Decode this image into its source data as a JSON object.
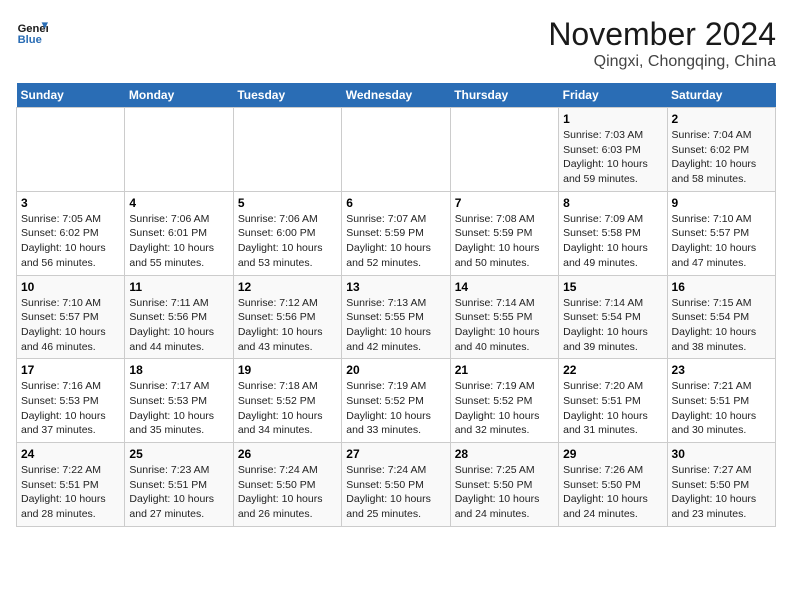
{
  "header": {
    "logo_line1": "General",
    "logo_line2": "Blue",
    "month": "November 2024",
    "location": "Qingxi, Chongqing, China"
  },
  "weekdays": [
    "Sunday",
    "Monday",
    "Tuesday",
    "Wednesday",
    "Thursday",
    "Friday",
    "Saturday"
  ],
  "weeks": [
    [
      {
        "day": "",
        "info": ""
      },
      {
        "day": "",
        "info": ""
      },
      {
        "day": "",
        "info": ""
      },
      {
        "day": "",
        "info": ""
      },
      {
        "day": "",
        "info": ""
      },
      {
        "day": "1",
        "info": "Sunrise: 7:03 AM\nSunset: 6:03 PM\nDaylight: 10 hours and 59 minutes."
      },
      {
        "day": "2",
        "info": "Sunrise: 7:04 AM\nSunset: 6:02 PM\nDaylight: 10 hours and 58 minutes."
      }
    ],
    [
      {
        "day": "3",
        "info": "Sunrise: 7:05 AM\nSunset: 6:02 PM\nDaylight: 10 hours and 56 minutes."
      },
      {
        "day": "4",
        "info": "Sunrise: 7:06 AM\nSunset: 6:01 PM\nDaylight: 10 hours and 55 minutes."
      },
      {
        "day": "5",
        "info": "Sunrise: 7:06 AM\nSunset: 6:00 PM\nDaylight: 10 hours and 53 minutes."
      },
      {
        "day": "6",
        "info": "Sunrise: 7:07 AM\nSunset: 5:59 PM\nDaylight: 10 hours and 52 minutes."
      },
      {
        "day": "7",
        "info": "Sunrise: 7:08 AM\nSunset: 5:59 PM\nDaylight: 10 hours and 50 minutes."
      },
      {
        "day": "8",
        "info": "Sunrise: 7:09 AM\nSunset: 5:58 PM\nDaylight: 10 hours and 49 minutes."
      },
      {
        "day": "9",
        "info": "Sunrise: 7:10 AM\nSunset: 5:57 PM\nDaylight: 10 hours and 47 minutes."
      }
    ],
    [
      {
        "day": "10",
        "info": "Sunrise: 7:10 AM\nSunset: 5:57 PM\nDaylight: 10 hours and 46 minutes."
      },
      {
        "day": "11",
        "info": "Sunrise: 7:11 AM\nSunset: 5:56 PM\nDaylight: 10 hours and 44 minutes."
      },
      {
        "day": "12",
        "info": "Sunrise: 7:12 AM\nSunset: 5:56 PM\nDaylight: 10 hours and 43 minutes."
      },
      {
        "day": "13",
        "info": "Sunrise: 7:13 AM\nSunset: 5:55 PM\nDaylight: 10 hours and 42 minutes."
      },
      {
        "day": "14",
        "info": "Sunrise: 7:14 AM\nSunset: 5:55 PM\nDaylight: 10 hours and 40 minutes."
      },
      {
        "day": "15",
        "info": "Sunrise: 7:14 AM\nSunset: 5:54 PM\nDaylight: 10 hours and 39 minutes."
      },
      {
        "day": "16",
        "info": "Sunrise: 7:15 AM\nSunset: 5:54 PM\nDaylight: 10 hours and 38 minutes."
      }
    ],
    [
      {
        "day": "17",
        "info": "Sunrise: 7:16 AM\nSunset: 5:53 PM\nDaylight: 10 hours and 37 minutes."
      },
      {
        "day": "18",
        "info": "Sunrise: 7:17 AM\nSunset: 5:53 PM\nDaylight: 10 hours and 35 minutes."
      },
      {
        "day": "19",
        "info": "Sunrise: 7:18 AM\nSunset: 5:52 PM\nDaylight: 10 hours and 34 minutes."
      },
      {
        "day": "20",
        "info": "Sunrise: 7:19 AM\nSunset: 5:52 PM\nDaylight: 10 hours and 33 minutes."
      },
      {
        "day": "21",
        "info": "Sunrise: 7:19 AM\nSunset: 5:52 PM\nDaylight: 10 hours and 32 minutes."
      },
      {
        "day": "22",
        "info": "Sunrise: 7:20 AM\nSunset: 5:51 PM\nDaylight: 10 hours and 31 minutes."
      },
      {
        "day": "23",
        "info": "Sunrise: 7:21 AM\nSunset: 5:51 PM\nDaylight: 10 hours and 30 minutes."
      }
    ],
    [
      {
        "day": "24",
        "info": "Sunrise: 7:22 AM\nSunset: 5:51 PM\nDaylight: 10 hours and 28 minutes."
      },
      {
        "day": "25",
        "info": "Sunrise: 7:23 AM\nSunset: 5:51 PM\nDaylight: 10 hours and 27 minutes."
      },
      {
        "day": "26",
        "info": "Sunrise: 7:24 AM\nSunset: 5:50 PM\nDaylight: 10 hours and 26 minutes."
      },
      {
        "day": "27",
        "info": "Sunrise: 7:24 AM\nSunset: 5:50 PM\nDaylight: 10 hours and 25 minutes."
      },
      {
        "day": "28",
        "info": "Sunrise: 7:25 AM\nSunset: 5:50 PM\nDaylight: 10 hours and 24 minutes."
      },
      {
        "day": "29",
        "info": "Sunrise: 7:26 AM\nSunset: 5:50 PM\nDaylight: 10 hours and 24 minutes."
      },
      {
        "day": "30",
        "info": "Sunrise: 7:27 AM\nSunset: 5:50 PM\nDaylight: 10 hours and 23 minutes."
      }
    ]
  ]
}
